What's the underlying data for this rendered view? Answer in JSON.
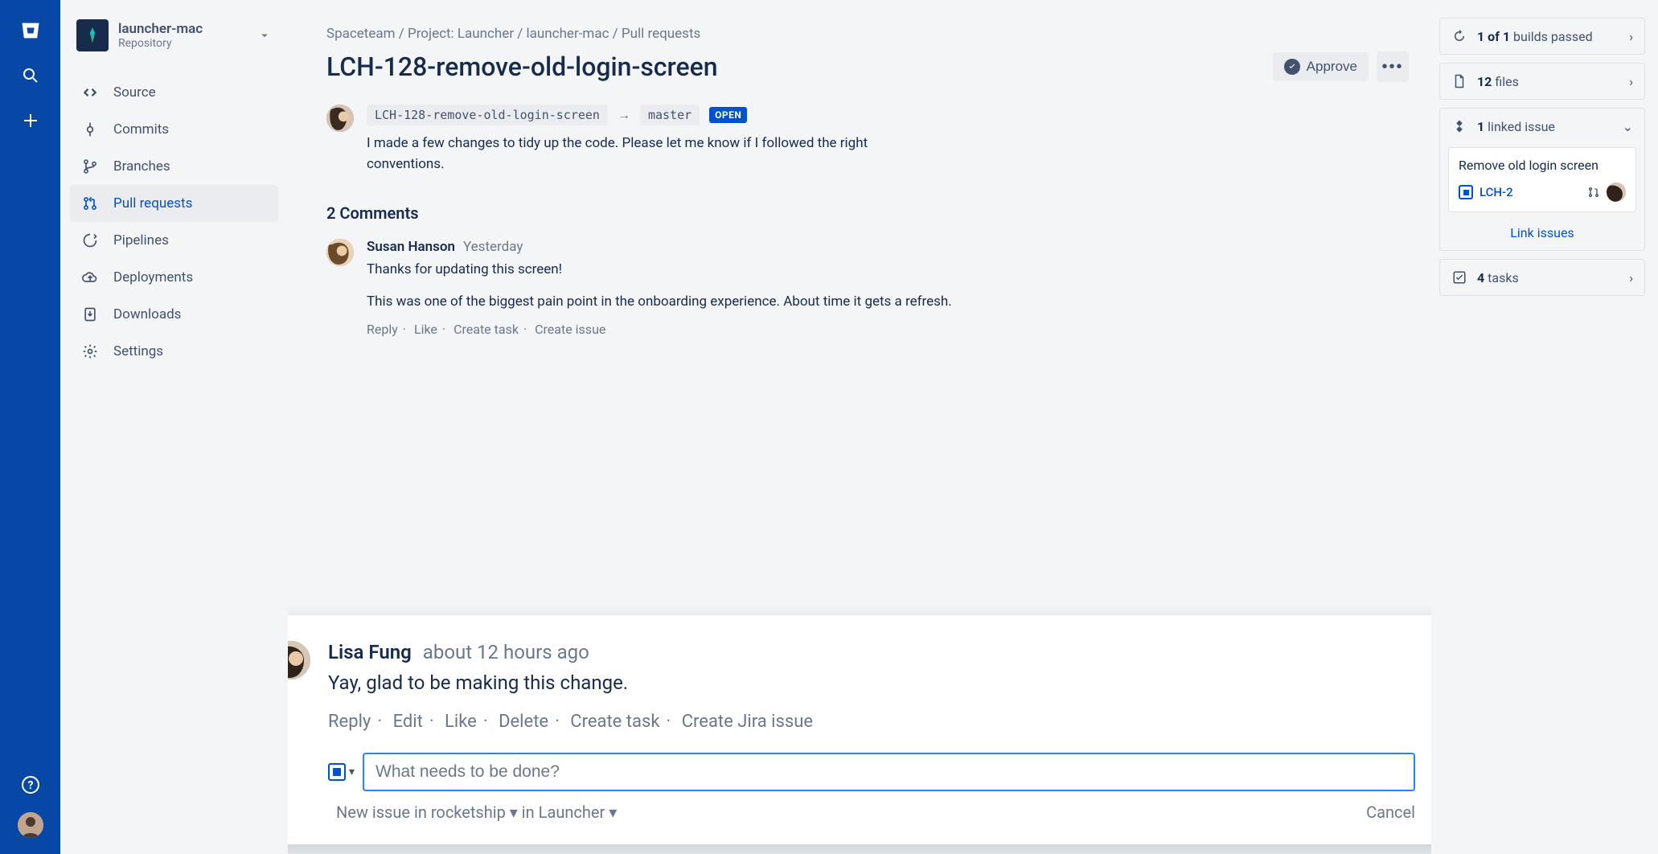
{
  "global_nav": {
    "product_icon": "bitbucket-icon",
    "search_icon": "search-icon",
    "create_icon": "plus-icon",
    "help_icon": "help-icon"
  },
  "project": {
    "name": "launcher-mac",
    "type": "Repository"
  },
  "sidebar": {
    "items": [
      {
        "label": "Source",
        "icon": "code-icon"
      },
      {
        "label": "Commits",
        "icon": "commit-icon"
      },
      {
        "label": "Branches",
        "icon": "branch-icon"
      },
      {
        "label": "Pull requests",
        "icon": "pullrequest-icon"
      },
      {
        "label": "Pipelines",
        "icon": "pipeline-icon"
      },
      {
        "label": "Deployments",
        "icon": "cloud-upload-icon"
      },
      {
        "label": "Downloads",
        "icon": "download-icon"
      },
      {
        "label": "Settings",
        "icon": "gear-icon"
      }
    ]
  },
  "breadcrumbs": {
    "a": "Spaceteam",
    "b": "Project: Launcher",
    "c": "launcher-mac",
    "d": "Pull requests"
  },
  "page": {
    "title": "LCH-128-remove-old-login-screen",
    "approve_label": "Approve",
    "source_branch": "LCH-128-remove-old-login-screen",
    "target_branch": "master",
    "status": "OPEN",
    "description": "I made a few changes to tidy up the code. Please let me know if I followed the right conventions."
  },
  "comments": {
    "heading": "2 Comments",
    "list": [
      {
        "author": "Susan Hanson",
        "time": "Yesterday",
        "text1": "Thanks for updating this screen!",
        "text2": "This was one of the biggest pain point in the onboarding experience. About time it gets a refresh.",
        "actions": {
          "reply": "Reply",
          "like": "Like",
          "create_task": "Create task",
          "create_issue": "Create issue"
        }
      }
    ]
  },
  "popup": {
    "author": "Lisa Fung",
    "time": "about 12 hours ago",
    "text": "Yay, glad to be making this change.",
    "actions": {
      "reply": "Reply",
      "edit": "Edit",
      "like": "Like",
      "delete": "Delete",
      "create_task": "Create task",
      "create_jira": "Create Jira issue"
    },
    "input_placeholder": "What needs to be done?",
    "footer_prefix": "New issue in ",
    "footer_project": "rocketship",
    "footer_mid": " in ",
    "footer_container": "Launcher",
    "cancel": "Cancel"
  },
  "right": {
    "builds": {
      "bold1": "1 of 1",
      "rest": " builds passed"
    },
    "files": {
      "bold": "12",
      "rest": " files"
    },
    "linked": {
      "bold": "1",
      "rest": " linked issue"
    },
    "linked_issue": {
      "title": "Remove old login screen",
      "key": "LCH-2"
    },
    "link_issues": "Link issues",
    "tasks": {
      "bold": "4",
      "rest": " tasks"
    }
  }
}
